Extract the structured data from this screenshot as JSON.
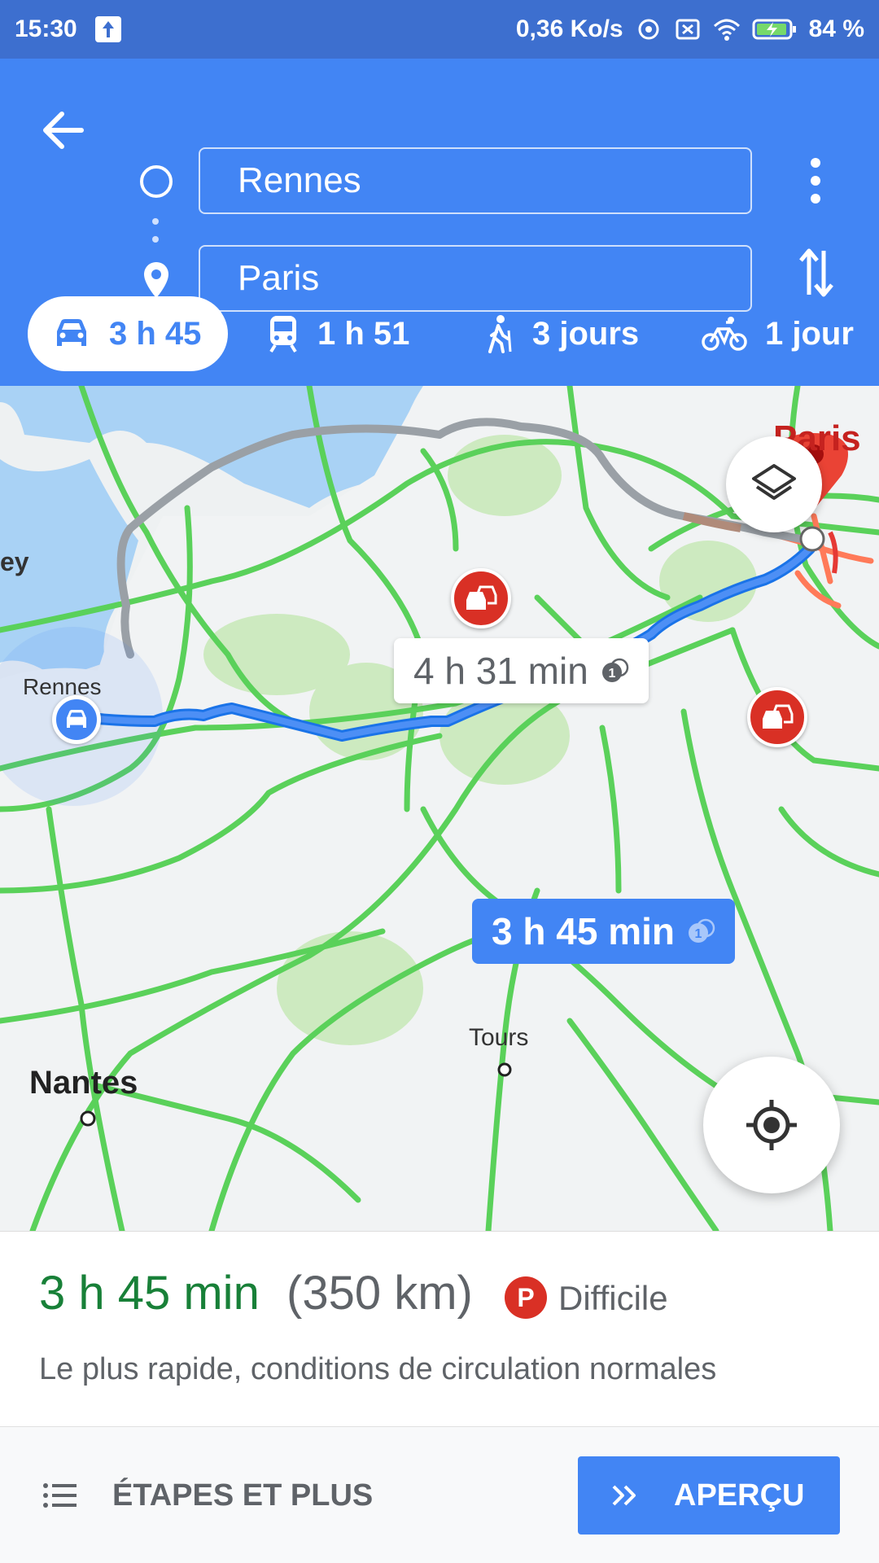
{
  "status_bar": {
    "time": "15:30",
    "speed": "0,36 Ko/s",
    "battery": "84 %"
  },
  "directions": {
    "origin": "Rennes",
    "destination": "Paris"
  },
  "modes": [
    {
      "label": "3 h 45",
      "icon": "car-icon"
    },
    {
      "label": "1 h 51",
      "icon": "train-icon"
    },
    {
      "label": "3 jours",
      "icon": "walk-icon"
    },
    {
      "label": "1 jour",
      "icon": "bike-icon"
    }
  ],
  "map": {
    "labels": {
      "rennes": "Rennes",
      "paris": "Paris",
      "nantes": "Nantes",
      "tours": "Tours",
      "edge": "ey"
    },
    "route_alt_time": "4 h 31 min",
    "route_main_time": "3 h 45 min",
    "route_badge_number": "1"
  },
  "summary": {
    "duration": "3 h 45 min",
    "distance": "(350 km)",
    "parking_badge": "P",
    "parking": "Difficile",
    "description": "Le plus rapide, conditions de circulation normales"
  },
  "footer": {
    "steps_label": "ÉTAPES ET PLUS",
    "preview_label": "APERÇU"
  },
  "colors": {
    "header": "#4285f4",
    "statusbar": "#3d6fcf",
    "route_main": "#4285f4",
    "route_alt": "#9aa0a6",
    "traffic_green": "#4cd964",
    "traffic_red": "#d93025",
    "duration_green": "#188038"
  }
}
